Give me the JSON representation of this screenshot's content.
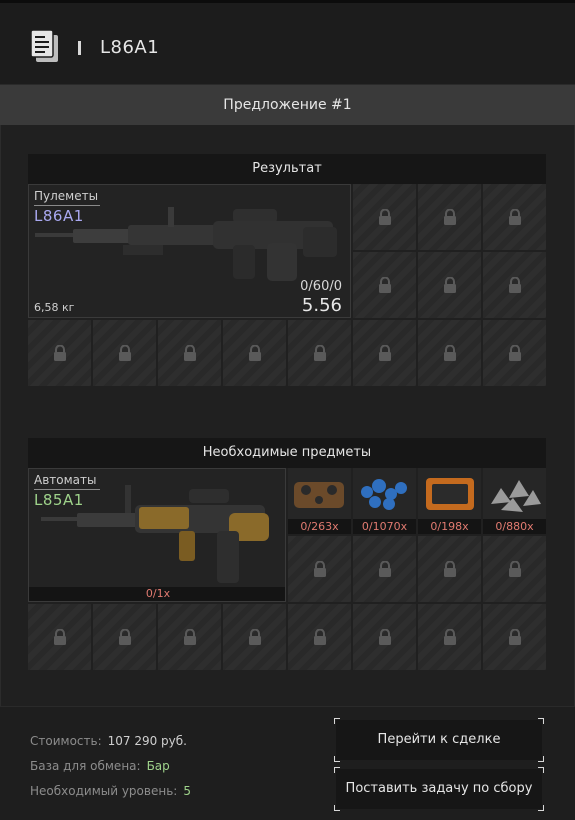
{
  "header": {
    "title": "L86A1",
    "icon": "document-icon"
  },
  "offer": {
    "label": "Предложение #1"
  },
  "result": {
    "section_title": "Результат",
    "item": {
      "category": "Пулеметы",
      "name": "L86A1",
      "name_color": "#a9a8f0",
      "weight": "6,58 кг",
      "ammo": "0/60/0",
      "caliber": "5.56"
    }
  },
  "required": {
    "section_title": "Необходимые предметы",
    "main_item": {
      "category": "Автоматы",
      "name": "L85A1",
      "name_color": "#9ed28a",
      "count": "0/1x"
    },
    "items": [
      {
        "icon": "brown-bolts-icon",
        "count": "0/263x"
      },
      {
        "icon": "blue-pellets-icon",
        "count": "0/1070x"
      },
      {
        "icon": "orange-case-icon",
        "count": "0/198x"
      },
      {
        "icon": "scrap-metal-icon",
        "count": "0/880x"
      }
    ]
  },
  "footer": {
    "cost_label": "Стоимость:",
    "cost_value": "107 290 руб.",
    "base_label": "База для обмена:",
    "base_value": "Бар",
    "level_label": "Необходимый уровень:",
    "level_value": "5",
    "go_button": "Перейти к сделке",
    "task_button": "Поставить задачу по сбору"
  },
  "colors": {
    "accent_green": "#9ed28a",
    "accent_purple": "#a9a8f0",
    "count_red": "#e07a70"
  }
}
